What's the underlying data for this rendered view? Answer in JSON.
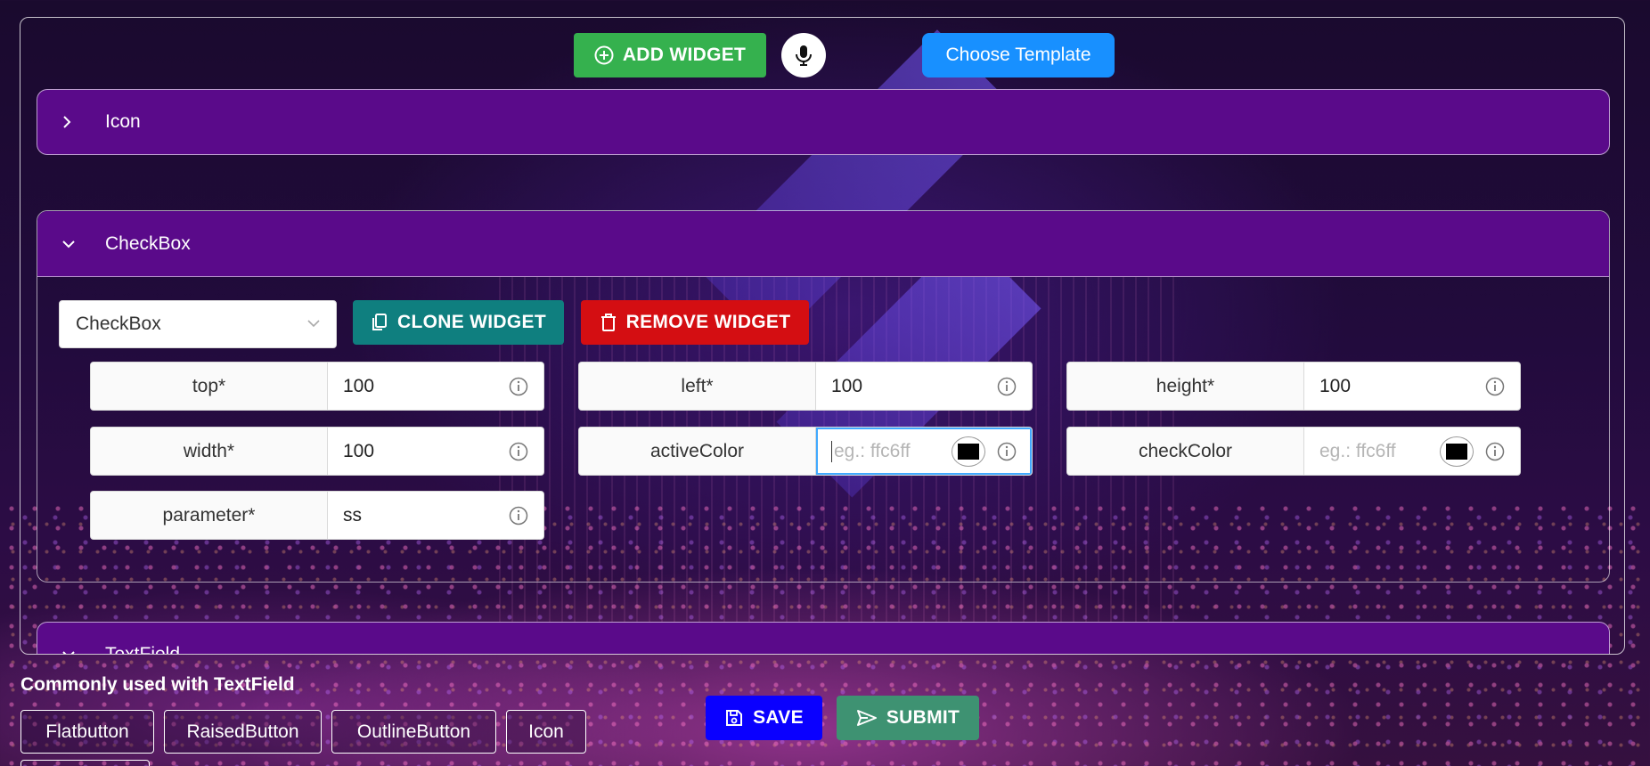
{
  "toolbar": {
    "add_widget": "ADD WIDGET",
    "choose_template": "Choose Template"
  },
  "accordions": [
    {
      "title": "Icon",
      "expanded": false
    },
    {
      "title": "CheckBox",
      "expanded": true
    },
    {
      "title": "TextField",
      "expanded": true
    }
  ],
  "checkbox_panel": {
    "widget_type": "CheckBox",
    "clone_label": "CLONE WIDGET",
    "remove_label": "REMOVE WIDGET",
    "fields": {
      "top": {
        "label": "top*",
        "value": "100"
      },
      "left": {
        "label": "left*",
        "value": "100"
      },
      "height": {
        "label": "height*",
        "value": "100"
      },
      "width": {
        "label": "width*",
        "value": "100"
      },
      "activeColor": {
        "label": "activeColor",
        "placeholder": "eg.: ffc6ff"
      },
      "checkColor": {
        "label": "checkColor",
        "placeholder": "eg.: ffc6ff"
      },
      "parameter": {
        "label": "parameter*",
        "value": "ss"
      }
    }
  },
  "commonly_used": {
    "title": "Commonly used with TextField",
    "chips": [
      "Flatbutton",
      "RaisedButton",
      "OutlineButton",
      "Icon"
    ]
  },
  "actions": {
    "save": "SAVE",
    "submit": "SUBMIT"
  },
  "colors": {
    "add_widget": "#35b14e",
    "choose_template": "#1890ff",
    "accordion_header": "#5a0a8a",
    "clone": "#0f7f7f",
    "remove": "#d40e12",
    "save": "#0a00ff",
    "submit": "#3e9272",
    "swatch": "#000000"
  }
}
